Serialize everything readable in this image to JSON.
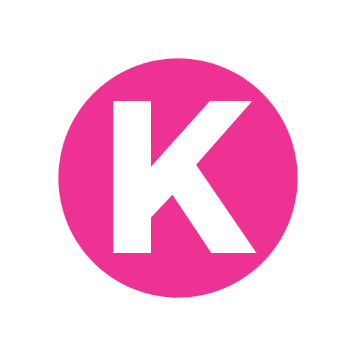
{
  "logo": {
    "letter": "K",
    "icon": "k-circle-logo-icon",
    "colors": {
      "circle": "#ED3294",
      "letter": "#FFFFFF",
      "background": "#FFFFFF"
    }
  }
}
